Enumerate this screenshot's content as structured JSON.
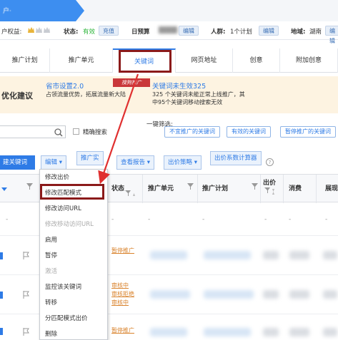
{
  "topbar": {
    "account_label": "户·"
  },
  "infobar": {
    "benefit_label": "户权益:",
    "status_label": "状态:",
    "status_value": "有效",
    "recharge_btn": "充值",
    "daily_budget_label": "日预算",
    "budget_edit_btn": "编辑",
    "crowd_label": "人群:",
    "crowd_value": "1个计划",
    "crowd_edit_btn": "编辑",
    "region_label": "地域:",
    "region_value": "湖南",
    "region_edit_btn": "编辑"
  },
  "tabs": [
    {
      "label": "推广计划"
    },
    {
      "label": "推广单元"
    },
    {
      "label": "关键词"
    },
    {
      "label": "网页地址"
    },
    {
      "label": "创意"
    },
    {
      "label": "附加创意"
    }
  ],
  "suggestions": {
    "section_title": "优化建议",
    "stamp": "搜狗推广",
    "item1_title": "省市设置2.0",
    "item1_desc": "占领流量优势，拓展流量新大陆",
    "item2_title": "关键词未生效325",
    "item2_desc": "325 个关键词未能正常上线推广，其中95个关键词移动搜索无效"
  },
  "filters": {
    "exact_search_label": "精确搜索",
    "quick_filter_label": "一键筛选:",
    "quick_filters": [
      "不宜推广的关键词",
      "有效的关键词",
      "暂停推广的关键词"
    ]
  },
  "actions": {
    "add_keyword": "建关键词",
    "edit": "编辑",
    "promote_actual": "推广实",
    "view_report": "查看报告",
    "bid_strategy": "出价策略",
    "bid_calculator": "出价系数计算器",
    "help": "?"
  },
  "table": {
    "headers": [
      "状态",
      "推广单元",
      "推广计划",
      "出价",
      "消费",
      "展现"
    ],
    "placeholder": "-",
    "rows": [
      {
        "status": "暂停推广"
      },
      {
        "status": "审核中\n审核拒绝\n审核中"
      },
      {
        "status": "暂停推广"
      }
    ]
  },
  "dropdown": {
    "items": [
      {
        "label": "修改出价",
        "disabled": false
      },
      {
        "label": "修改匹配模式",
        "disabled": false
      },
      {
        "label": "修改访问URL",
        "disabled": false
      },
      {
        "label": "修改移动访问URL",
        "disabled": true
      },
      {
        "label": "启用",
        "disabled": false
      },
      {
        "label": "暂停",
        "disabled": false
      },
      {
        "label": "激活",
        "disabled": true
      },
      {
        "label": "监控该关键词",
        "disabled": false
      },
      {
        "label": "转移",
        "disabled": false
      },
      {
        "label": "分匹配模式出价",
        "disabled": false
      },
      {
        "label": "删除",
        "disabled": false
      }
    ]
  },
  "colors": {
    "accent": "#2e7be6",
    "highlight_box": "#8b1a1a",
    "arrow": "#e03030",
    "warning_bg": "#fdf3e1",
    "status_orange": "#d9822b"
  }
}
